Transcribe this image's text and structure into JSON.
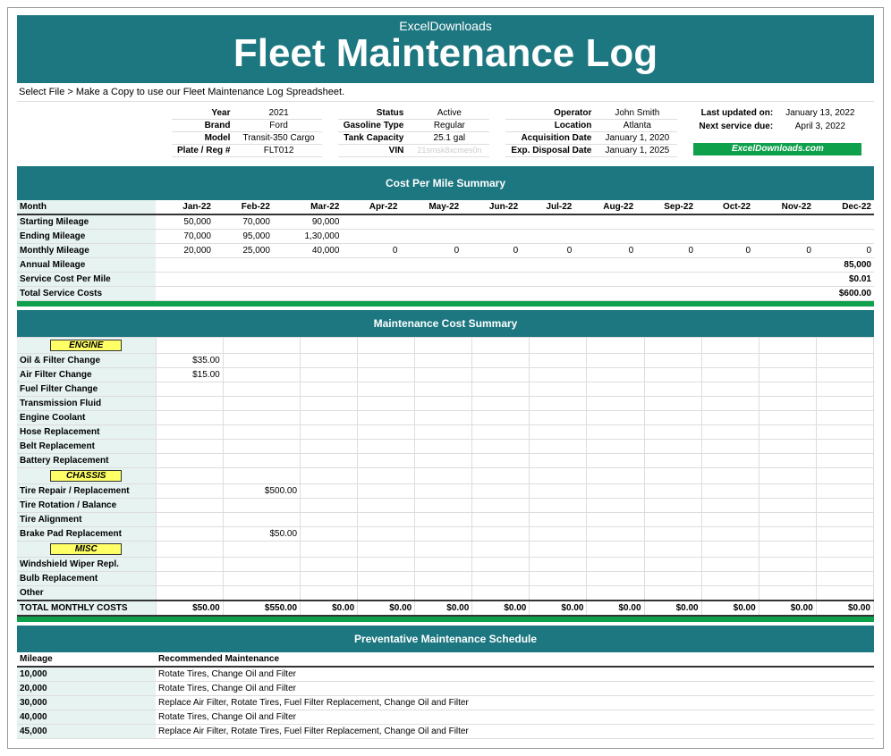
{
  "header": {
    "brand": "ExcelDownloads",
    "title": "Fleet Maintenance Log"
  },
  "instruction": "Select File > Make a Copy to use our Fleet Maintenance Log Spreadsheet.",
  "vehicle": {
    "year_lbl": "Year",
    "year": "2021",
    "brand_lbl": "Brand",
    "brand": "Ford",
    "model_lbl": "Model",
    "model": "Transit-350 Cargo",
    "plate_lbl": "Plate / Reg #",
    "plate": "FLT012"
  },
  "status": {
    "status_lbl": "Status",
    "status": "Active",
    "gas_lbl": "Gasoline Type",
    "gas": "Regular",
    "tank_lbl": "Tank Capacity",
    "tank": "25.1 gal",
    "vin_lbl": "VIN",
    "vin": "21smsk8xcmes0n"
  },
  "assign": {
    "op_lbl": "Operator",
    "op": "John Smith",
    "loc_lbl": "Location",
    "loc": "Atlanta",
    "acq_lbl": "Acquisition Date",
    "acq": "January 1, 2020",
    "disp_lbl": "Exp. Disposal Date",
    "disp": "January 1, 2025"
  },
  "meta": {
    "upd_lbl": "Last updated on:",
    "upd": "January 13, 2022",
    "next_lbl": "Next service due:",
    "next": "April 3, 2022",
    "site": "ExcelDownloads.com"
  },
  "cpm": {
    "title": "Cost Per Mile Summary",
    "months": [
      "Jan-22",
      "Feb-22",
      "Mar-22",
      "Apr-22",
      "May-22",
      "Jun-22",
      "Jul-22",
      "Aug-22",
      "Sep-22",
      "Oct-22",
      "Nov-22",
      "Dec-22"
    ],
    "month_lbl": "Month",
    "rows": {
      "start": {
        "lbl": "Starting Mileage",
        "v": [
          "50,000",
          "70,000",
          "90,000",
          "",
          "",
          "",
          "",
          "",
          "",
          "",
          "",
          ""
        ]
      },
      "end": {
        "lbl": "Ending Mileage",
        "v": [
          "70,000",
          "95,000",
          "1,30,000",
          "",
          "",
          "",
          "",
          "",
          "",
          "",
          "",
          ""
        ]
      },
      "mon": {
        "lbl": "Monthly Mileage",
        "v": [
          "20,000",
          "25,000",
          "40,000",
          "0",
          "0",
          "0",
          "0",
          "0",
          "0",
          "0",
          "0",
          "0"
        ]
      }
    },
    "annual_lbl": "Annual Mileage",
    "annual": "85,000",
    "scpm_lbl": "Service Cost Per Mile",
    "scpm": "$0.01",
    "tsc_lbl": "Total Service Costs",
    "tsc": "$600.00"
  },
  "mcs": {
    "title": "Maintenance Cost Summary",
    "cats": {
      "engine": "ENGINE",
      "engine_rows": [
        {
          "lbl": "Oil & Filter Change",
          "v": [
            "$35.00",
            "",
            "",
            "",
            "",
            "",
            "",
            "",
            "",
            "",
            "",
            ""
          ]
        },
        {
          "lbl": "Air Filter Change",
          "v": [
            "$15.00",
            "",
            "",
            "",
            "",
            "",
            "",
            "",
            "",
            "",
            "",
            ""
          ]
        },
        {
          "lbl": "Fuel Filter Change",
          "v": [
            "",
            "",
            "",
            "",
            "",
            "",
            "",
            "",
            "",
            "",
            "",
            ""
          ]
        },
        {
          "lbl": "Transmission Fluid",
          "v": [
            "",
            "",
            "",
            "",
            "",
            "",
            "",
            "",
            "",
            "",
            "",
            ""
          ]
        },
        {
          "lbl": "Engine Coolant",
          "v": [
            "",
            "",
            "",
            "",
            "",
            "",
            "",
            "",
            "",
            "",
            "",
            ""
          ]
        },
        {
          "lbl": "Hose Replacement",
          "v": [
            "",
            "",
            "",
            "",
            "",
            "",
            "",
            "",
            "",
            "",
            "",
            ""
          ]
        },
        {
          "lbl": "Belt Replacement",
          "v": [
            "",
            "",
            "",
            "",
            "",
            "",
            "",
            "",
            "",
            "",
            "",
            ""
          ]
        },
        {
          "lbl": "Battery Replacement",
          "v": [
            "",
            "",
            "",
            "",
            "",
            "",
            "",
            "",
            "",
            "",
            "",
            ""
          ]
        }
      ],
      "chassis": "CHASSIS",
      "chassis_rows": [
        {
          "lbl": "Tire Repair / Replacement",
          "v": [
            "",
            "$500.00",
            "",
            "",
            "",
            "",
            "",
            "",
            "",
            "",
            "",
            ""
          ]
        },
        {
          "lbl": "Tire Rotation / Balance",
          "v": [
            "",
            "",
            "",
            "",
            "",
            "",
            "",
            "",
            "",
            "",
            "",
            ""
          ]
        },
        {
          "lbl": "Tire Alignment",
          "v": [
            "",
            "",
            "",
            "",
            "",
            "",
            "",
            "",
            "",
            "",
            "",
            ""
          ]
        },
        {
          "lbl": "Brake Pad Replacement",
          "v": [
            "",
            "$50.00",
            "",
            "",
            "",
            "",
            "",
            "",
            "",
            "",
            "",
            ""
          ]
        }
      ],
      "misc": "MISC",
      "misc_rows": [
        {
          "lbl": "Windshield Wiper Repl.",
          "v": [
            "",
            "",
            "",
            "",
            "",
            "",
            "",
            "",
            "",
            "",
            "",
            ""
          ]
        },
        {
          "lbl": "Bulb Replacement",
          "v": [
            "",
            "",
            "",
            "",
            "",
            "",
            "",
            "",
            "",
            "",
            "",
            ""
          ]
        },
        {
          "lbl": "Other",
          "v": [
            "",
            "",
            "",
            "",
            "",
            "",
            "",
            "",
            "",
            "",
            "",
            ""
          ]
        }
      ]
    },
    "total_lbl": "TOTAL MONTHLY COSTS",
    "totals": [
      "$50.00",
      "$550.00",
      "$0.00",
      "$0.00",
      "$0.00",
      "$0.00",
      "$0.00",
      "$0.00",
      "$0.00",
      "$0.00",
      "$0.00",
      "$0.00"
    ]
  },
  "pm": {
    "title": "Preventative Maintenance Schedule",
    "col1": "Mileage",
    "col2": "Recommended Maintenance",
    "rows": [
      {
        "m": "10,000",
        "r": "Rotate Tires, Change Oil and Filter"
      },
      {
        "m": "20,000",
        "r": "Rotate Tires, Change Oil and Filter"
      },
      {
        "m": "30,000",
        "r": "Replace Air Filter, Rotate Tires, Fuel Filter Replacement, Change Oil and Filter"
      },
      {
        "m": "40,000",
        "r": "Rotate Tires, Change Oil and Filter"
      },
      {
        "m": "45,000",
        "r": "Replace Air Filter, Rotate Tires, Fuel Filter Replacement, Change Oil and Filter"
      }
    ]
  }
}
